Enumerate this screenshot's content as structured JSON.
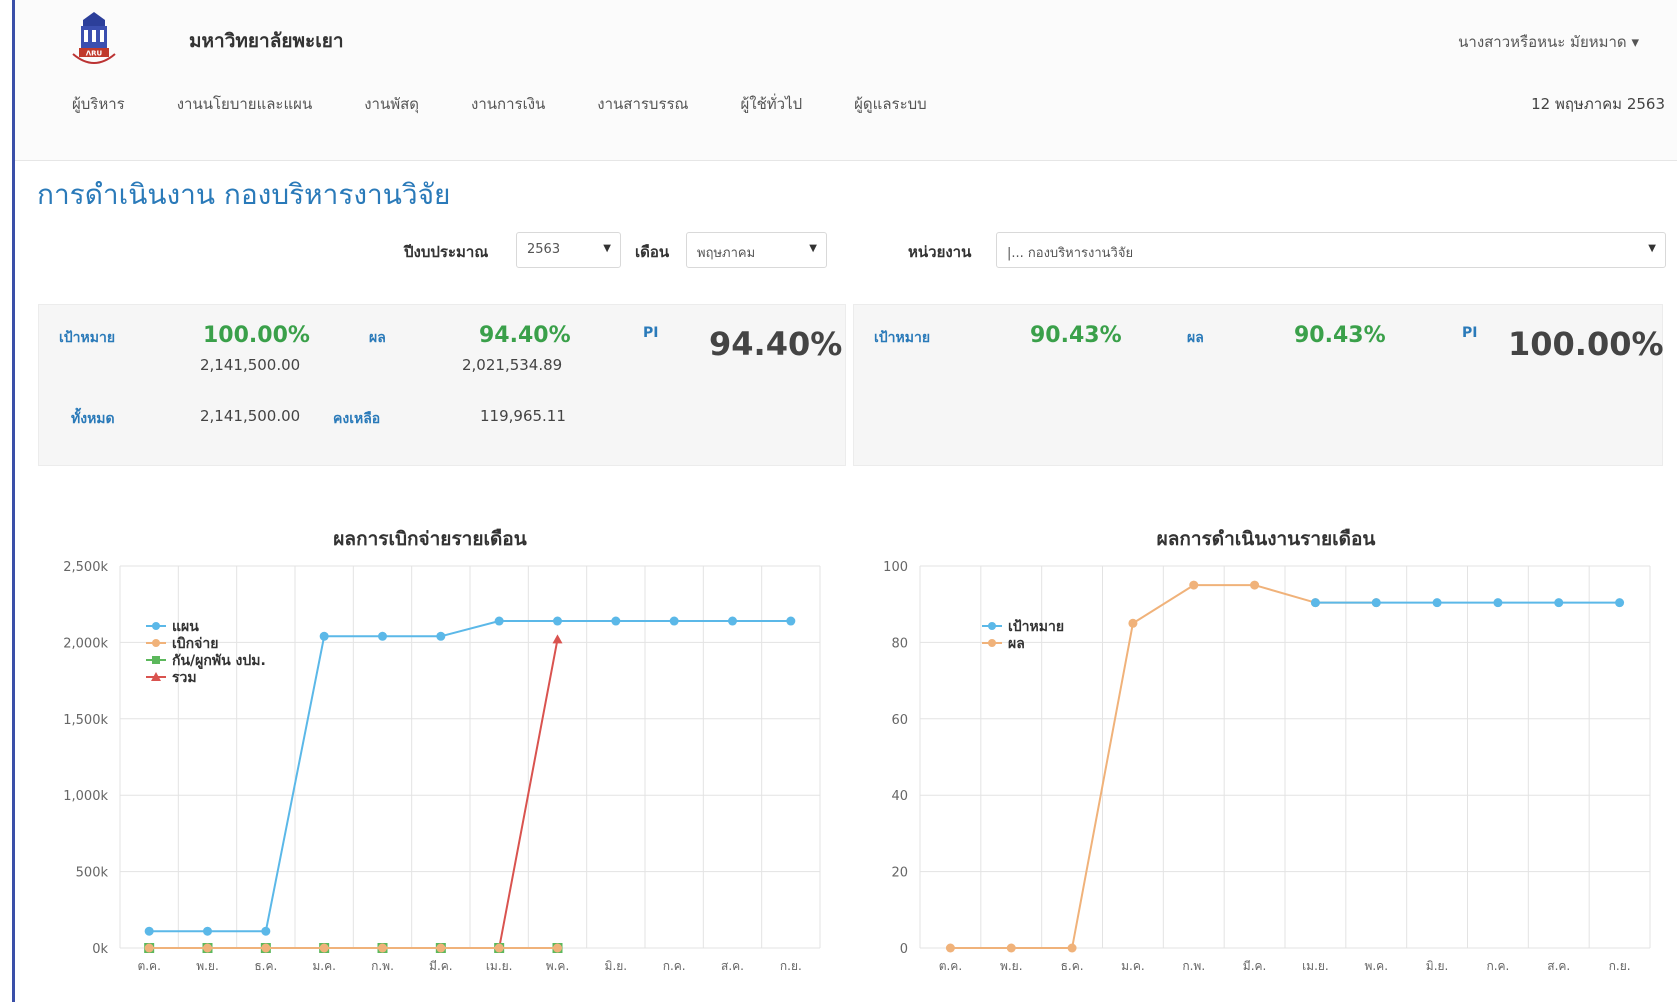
{
  "header": {
    "university_name": "มหาวิทยาลัยพะเยา",
    "user_name": "นางสาวหรือหนะ มัยหมาด",
    "date": "12 พฤษภาคม 2563",
    "nav": [
      "ผู้บริหาร",
      "งานนโยบายและแผน",
      "งานพัสดุ",
      "งานการเงิน",
      "งานสารบรรณ",
      "ผู้ใช้ทั่วไป",
      "ผู้ดูแลระบบ"
    ]
  },
  "page_title": "การดำเนินงาน กองบริหารงานวิจัย",
  "filters": {
    "year_label": "ปีงบประมาณ",
    "year_value": "2563",
    "month_label": "เดือน",
    "month_value": "พฤษภาคม",
    "unit_label": "หน่วยงาน",
    "unit_value": "|... กองบริหารงานวิจัย"
  },
  "summary_left": {
    "target_label": "เป้าหมาย",
    "target_pct": "100.00%",
    "target_amount": "2,141,500.00",
    "result_label": "ผล",
    "result_pct": "94.40%",
    "result_amount": "2,021,534.89",
    "pi_label": "PI",
    "pi_value": "94.40%",
    "total_label": "ทั้งหมด",
    "total_amount": "2,141,500.00",
    "remain_label": "คงเหลือ",
    "remain_amount": "119,965.11"
  },
  "summary_right": {
    "target_label": "เป้าหมาย",
    "target_pct": "90.43%",
    "result_label": "ผล",
    "result_pct": "90.43%",
    "pi_label": "PI",
    "pi_value": "100.00%"
  },
  "colors": {
    "blue": "#5bb8e8",
    "orange": "#f0b27a",
    "green": "#5cb85c",
    "red": "#d9534f",
    "title_blue": "#2a7ab9"
  },
  "chart_data": [
    {
      "type": "line",
      "title": "ผลการเบิกจ่ายรายเดือน",
      "categories": [
        "ต.ค.",
        "พ.ย.",
        "ธ.ค.",
        "ม.ค.",
        "ก.พ.",
        "มี.ค.",
        "เม.ย.",
        "พ.ค.",
        "มิ.ย.",
        "ก.ค.",
        "ส.ค.",
        "ก.ย."
      ],
      "y_ticks": [
        "0k",
        "500k",
        "1,000k",
        "1,500k",
        "2,000k",
        "2,500k"
      ],
      "ylim": [
        0,
        2500
      ],
      "legend_position": "top-left",
      "series": [
        {
          "name": "แผน",
          "marker": "circle",
          "color": "#5bb8e8",
          "values": [
            110,
            110,
            110,
            2040,
            2040,
            2040,
            2140,
            2140,
            2140,
            2140,
            2140,
            2140
          ]
        },
        {
          "name": "เบิกจ่าย",
          "marker": "circle",
          "color": "#f0b27a",
          "values": [
            0,
            0,
            0,
            0,
            0,
            0,
            0,
            0,
            null,
            null,
            null,
            null
          ]
        },
        {
          "name": "กัน/ผูกพัน งปม.",
          "marker": "square",
          "color": "#5cb85c",
          "values": [
            0,
            0,
            0,
            0,
            0,
            0,
            0,
            0,
            null,
            null,
            null,
            null
          ]
        },
        {
          "name": "รวม",
          "marker": "triangle",
          "color": "#d9534f",
          "values": [
            0,
            0,
            0,
            0,
            0,
            0,
            0,
            2020,
            null,
            null,
            null,
            null
          ]
        }
      ]
    },
    {
      "type": "line",
      "title": "ผลการดำเนินงานรายเดือน",
      "categories": [
        "ต.ค.",
        "พ.ย.",
        "ธ.ค.",
        "ม.ค.",
        "ก.พ.",
        "มี.ค.",
        "เม.ย.",
        "พ.ค.",
        "มิ.ย.",
        "ก.ค.",
        "ส.ค.",
        "ก.ย."
      ],
      "y_ticks": [
        "0",
        "20",
        "40",
        "60",
        "80",
        "100"
      ],
      "ylim": [
        0,
        100
      ],
      "legend_position": "top-left",
      "series": [
        {
          "name": "เป้าหมาย",
          "marker": "circle",
          "color": "#5bb8e8",
          "values": [
            null,
            null,
            null,
            null,
            null,
            null,
            90.4,
            90.4,
            90.4,
            90.4,
            90.4,
            90.4
          ]
        },
        {
          "name": "ผล",
          "marker": "circle",
          "color": "#f0b27a",
          "values": [
            0,
            0,
            0,
            85,
            95,
            95,
            90.4,
            90.4,
            null,
            null,
            null,
            null
          ]
        }
      ]
    }
  ]
}
